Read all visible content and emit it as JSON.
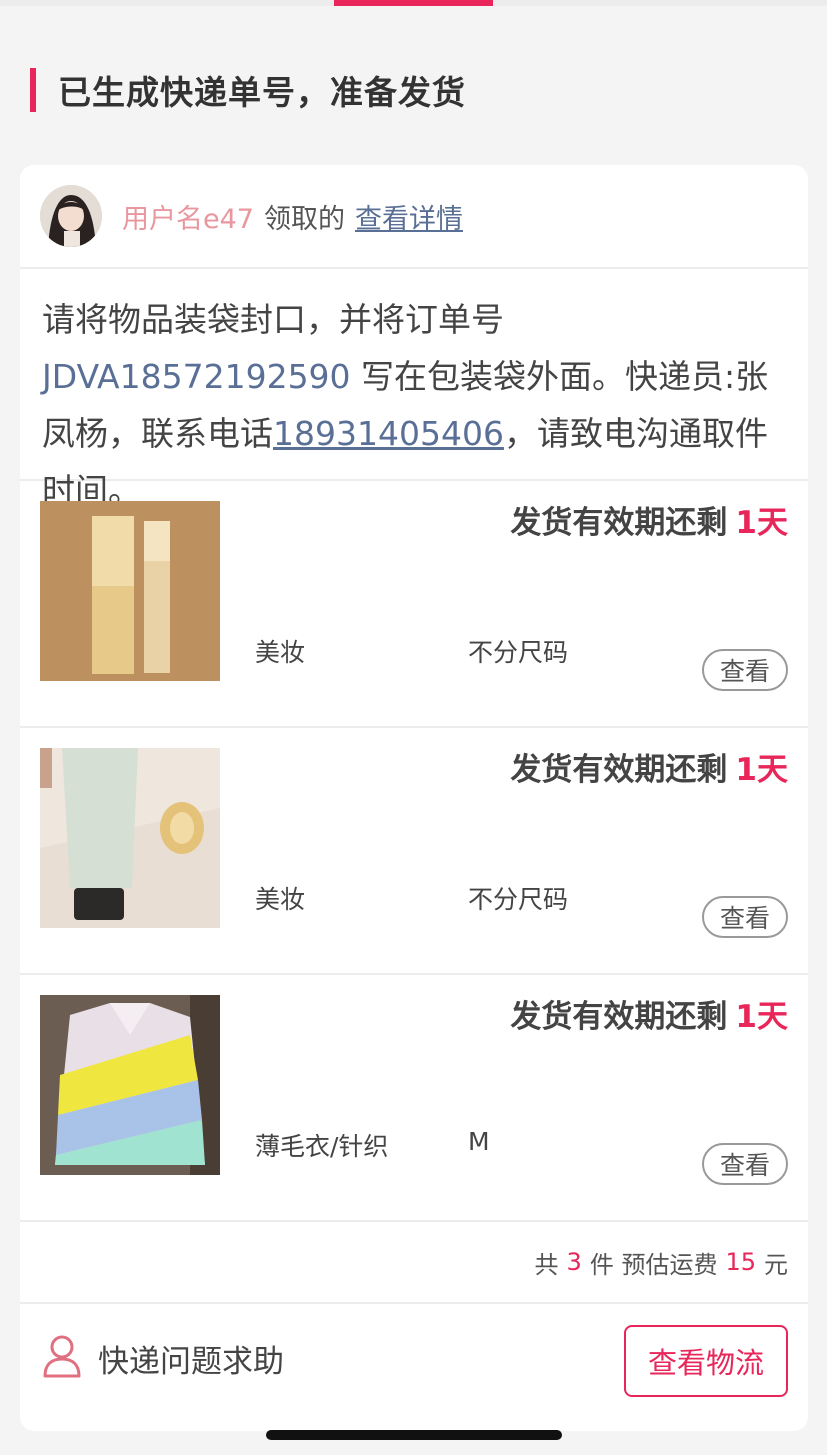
{
  "header": {
    "title": "已生成快递单号，准备发货"
  },
  "claimant": {
    "username": "用户名e47",
    "received_text": "领取的",
    "detail_link": "查看详情"
  },
  "instructions": {
    "part1": "请将物品装袋封口，并将订单号 ",
    "order_no": "JDVA18572192590",
    "part2": " 写在包装袋外面。快递员:张凤杨，联系电话",
    "phone": "18931405406",
    "part3": "，请致电沟通取件时间。"
  },
  "items": [
    {
      "deadline_label": "发货有效期还剩",
      "days": "1天",
      "category": "美妆",
      "size": "不分尺码",
      "view_label": "查看"
    },
    {
      "deadline_label": "发货有效期还剩",
      "days": "1天",
      "category": "美妆",
      "size": "不分尺码",
      "view_label": "查看"
    },
    {
      "deadline_label": "发货有效期还剩",
      "days": "1天",
      "category": "薄毛衣/针织",
      "size": "M",
      "view_label": "查看"
    }
  ],
  "summary": {
    "prefix": "共",
    "count": "3",
    "middle": "件 预估运费",
    "fee": "15",
    "suffix": "元"
  },
  "footer": {
    "help_label": "快递问题求助",
    "logistics_label": "查看物流"
  },
  "colors": {
    "accent": "#e8265a",
    "link": "#5a6f96",
    "username": "#e8979f"
  }
}
